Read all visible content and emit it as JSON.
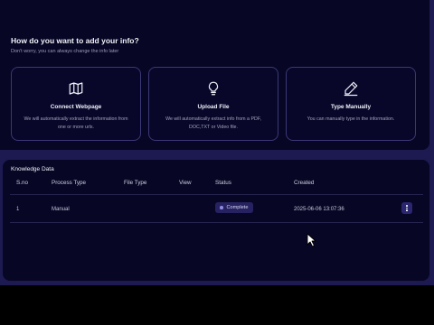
{
  "intro": {
    "heading": "How do you want to add your info?",
    "subheading": "Don't worry, you can always change the info later"
  },
  "cards": [
    {
      "icon": "map-icon",
      "title": "Connect Webpage",
      "description": "We will automatically extract the information from one or more urls."
    },
    {
      "icon": "lightbulb-icon",
      "title": "Upload File",
      "description": "We will automatically extract info from a PDF, DOC,TXT or Video file."
    },
    {
      "icon": "pencil-icon",
      "title": "Type Manually",
      "description": "You can manually type in the information."
    }
  ],
  "knowledge": {
    "title": "Knowledge Data",
    "columns": [
      "S.no",
      "Process Type",
      "File Type",
      "View",
      "Status",
      "Created"
    ],
    "rows": [
      {
        "sno": "1",
        "process_type": "Manual",
        "file_type": "",
        "view": "",
        "status": "Complete",
        "created": "2025-06-06 13:07:36"
      }
    ]
  },
  "colors": {
    "accent": "#8f8ae0",
    "background": "#070625",
    "border": "#3b3875"
  }
}
